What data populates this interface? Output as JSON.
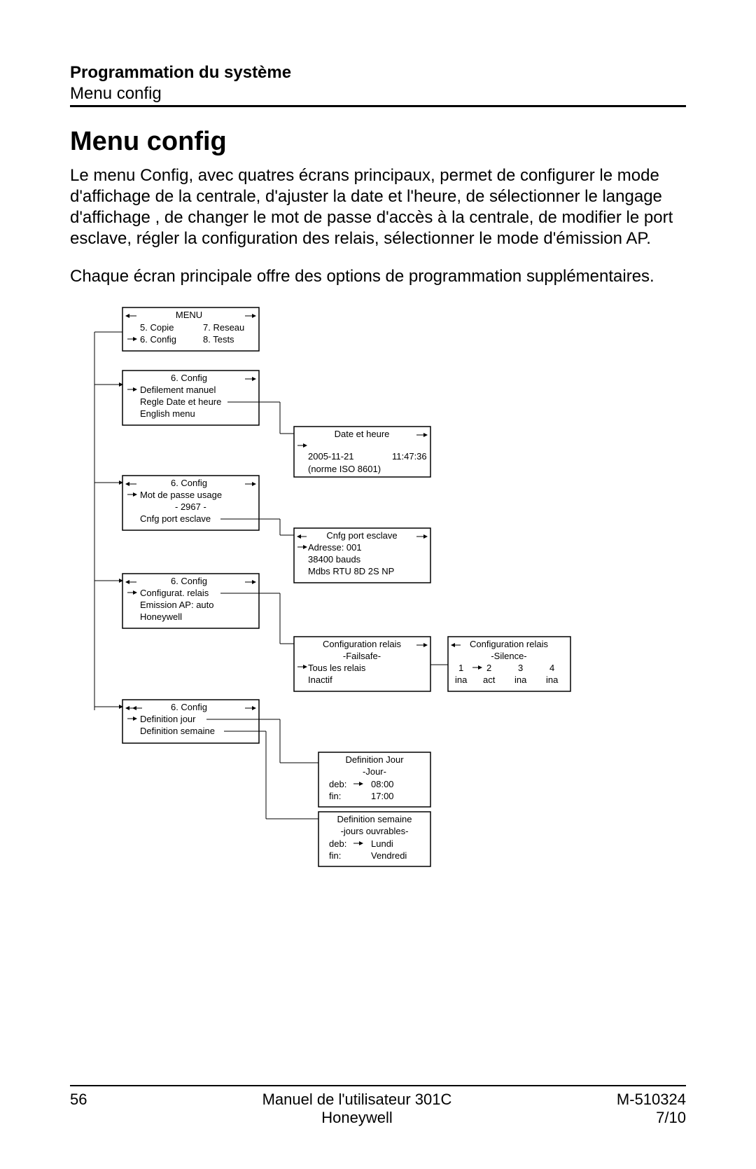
{
  "header": {
    "section": "Programmation du système",
    "subsection": "Menu config"
  },
  "title": "Menu config",
  "para1": "Le menu Config, avec quatres écrans principaux, permet de configurer le mode d'affichage de la centrale, d'ajuster la date et l'heure, de sélectionner le langage d'affichage , de changer le mot de passe d'accès à la centrale, de modifier le port esclave, régler la configuration des relais, sélectionner le mode d'émission AP.",
  "para2": "Chaque écran principale offre des options de programmation supplémentaires.",
  "diagram": {
    "box_menu": {
      "title": "MENU",
      "l1a": "5. Copie",
      "l1b": "7. Reseau",
      "l2a": "6. Config",
      "l2b": "8. Tests"
    },
    "box_config1": {
      "title": "6. Config",
      "l1": "Defilement manuel",
      "l2": "Regle Date et heure",
      "l3": "English menu"
    },
    "box_date": {
      "title": "Date et heure",
      "date": "2005-11-21",
      "time": "11:47:36",
      "note": "(norme ISO 8601)"
    },
    "box_config2": {
      "title": "6. Config",
      "l1": "Mot de passe usage",
      "l2": "- 2967 -",
      "l3": "Cnfg port esclave"
    },
    "box_port": {
      "title": "Cnfg port esclave",
      "l1": "Adresse: 001",
      "l2": "38400 bauds",
      "l3": "Mdbs RTU 8D 2S NP"
    },
    "box_config3": {
      "title": "6. Config",
      "l1": "Configurat. relais",
      "l2": "Emission AP: auto",
      "l3": "Honeywell"
    },
    "box_relais_fail": {
      "title": "Configuration relais",
      "sub": "-Failsafe-",
      "l1": "Tous les relais",
      "l2": "Inactif"
    },
    "box_relais_sil": {
      "title": "Configuration relais",
      "sub": "-Silence-",
      "cols": "1       2       3       4",
      "vals": "ina   act   ina   ina"
    },
    "box_config4": {
      "title": "6. Config",
      "l1": "Definition jour",
      "l2": "Definition semaine"
    },
    "box_jour": {
      "title": "Definition Jour",
      "sub": "-Jour-",
      "l1a": "deb:",
      "l1b": "08:00",
      "l2a": "fin:",
      "l2b": "17:00"
    },
    "box_semaine": {
      "title": "Definition semaine",
      "sub": "-jours ouvrables-",
      "l1a": "deb:",
      "l1b": "Lundi",
      "l2a": "fin:",
      "l2b": "Vendredi"
    }
  },
  "footer": {
    "page": "56",
    "center1": "Manuel  de l'utilisateur  301C",
    "center2": "Honeywell",
    "right1": "M-510324",
    "right2": "7/10"
  }
}
